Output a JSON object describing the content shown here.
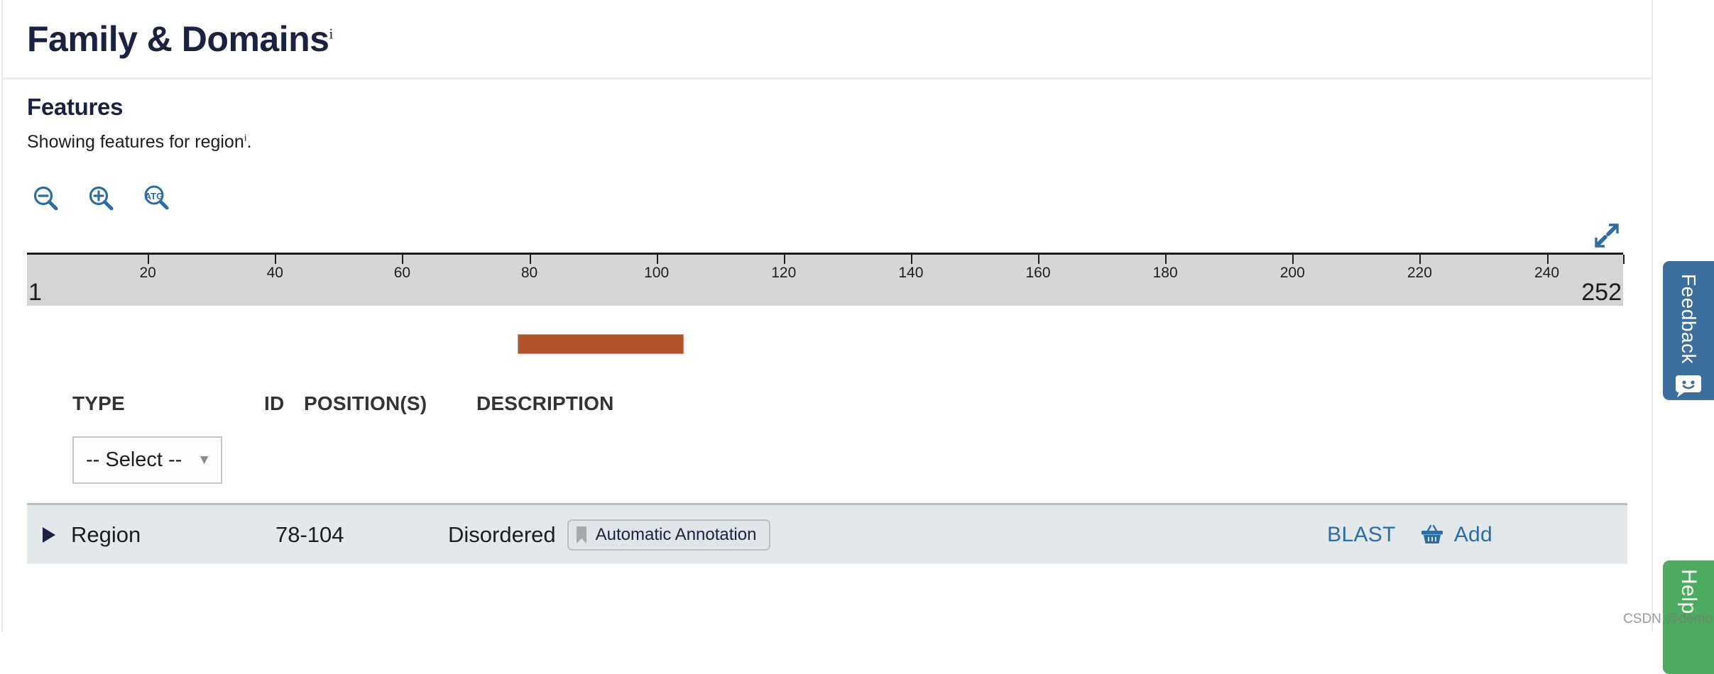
{
  "header": {
    "title": "Family & Domains",
    "info_superscript": "i"
  },
  "features": {
    "heading": "Features",
    "subtitle_text": "Showing features for region",
    "subtitle_superscript": "i",
    "subtitle_suffix": "."
  },
  "toolbar": {
    "zoom_out_icon": "zoom-out-icon",
    "zoom_in_icon": "zoom-in-icon",
    "sequence_icon": "atg-sequence-icon",
    "sequence_icon_label": "ATG",
    "expand_icon": "expand-fullscreen-icon"
  },
  "ruler": {
    "start_label": "1",
    "end_label": "252",
    "min": 1,
    "max": 252,
    "ticks": [
      {
        "value": 20,
        "label": "20"
      },
      {
        "value": 40,
        "label": "40"
      },
      {
        "value": 60,
        "label": "60"
      },
      {
        "value": 80,
        "label": "80"
      },
      {
        "value": 100,
        "label": "100"
      },
      {
        "value": 120,
        "label": "120"
      },
      {
        "value": 140,
        "label": "140"
      },
      {
        "value": 160,
        "label": "160"
      },
      {
        "value": 180,
        "label": "180"
      },
      {
        "value": 200,
        "label": "200"
      },
      {
        "value": 220,
        "label": "220"
      },
      {
        "value": 240,
        "label": "240"
      },
      {
        "value": 252,
        "label": ""
      }
    ]
  },
  "feature_track": {
    "features": [
      {
        "name": "Region",
        "start": 78,
        "end": 104,
        "color": "#b0542c"
      }
    ]
  },
  "table": {
    "columns": {
      "type": "TYPE",
      "id": "ID",
      "positions": "POSITION(S)",
      "description": "DESCRIPTION"
    },
    "type_filter": {
      "selected": "-- Select --",
      "caret": "▼"
    },
    "rows": [
      {
        "type": "Region",
        "id": "",
        "positions": "78-104",
        "description": "Disordered",
        "badge": "Automatic Annotation",
        "badge_icon": "bookmark-icon",
        "blast_label": "BLAST",
        "add_label": "Add",
        "add_icon": "basket-icon",
        "expand_icon": "caret-right-icon"
      }
    ]
  },
  "side_tabs": {
    "feedback_label": "Feedback",
    "feedback_icon": "smiley-speech-bubble-icon",
    "feedback_color": "#3d6f9e",
    "help_label": "Help",
    "help_color": "#4cab5e"
  },
  "watermark": {
    "text": "CSDN @demo"
  }
}
